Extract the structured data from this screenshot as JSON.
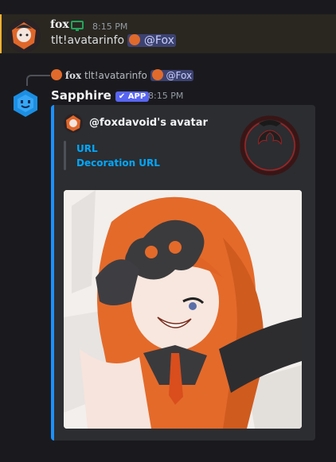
{
  "message1": {
    "author": "fox",
    "time": "8:15 PM",
    "content_prefix": "tlt!avatarinfo",
    "mention": "@Fox",
    "status_icon": "monitor-icon"
  },
  "reply": {
    "author": "fox",
    "content_prefix": "tlt!avatarinfo",
    "mention": "@Fox"
  },
  "message2": {
    "author": "Sapphire",
    "badge": "APP",
    "time": "8:15 PM"
  },
  "embed": {
    "title": "@foxdavoid's avatar",
    "links": [
      "URL",
      "Decoration URL"
    ],
    "accent_color": "#1e90ff"
  },
  "colors": {
    "background": "#1a1a1e",
    "highlight_bg": "#2a2721",
    "highlight_border": "#f0b232",
    "embed_bg": "#2b2d31",
    "link": "#00a8fc",
    "app_badge": "#5865f2"
  }
}
